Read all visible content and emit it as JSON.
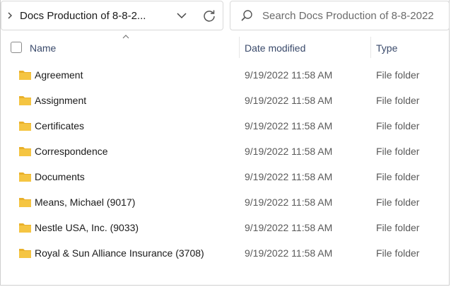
{
  "address_bar": {
    "path": "Docs Production of 8-8-2...",
    "expand_icon": "chevron-right-icon",
    "history_icon": "chevron-down-icon",
    "refresh_icon": "refresh-icon"
  },
  "search": {
    "placeholder": "Search Docs Production of 8-8-2022",
    "icon": "search-icon"
  },
  "columns": {
    "name": "Name",
    "date_modified": "Date modified",
    "type": "Type",
    "sort_icon": "sort-ascending-caret-icon"
  },
  "rows": [
    {
      "name": "Agreement",
      "date": "9/19/2022 11:58 AM",
      "type": "File folder"
    },
    {
      "name": "Assignment",
      "date": "9/19/2022 11:58 AM",
      "type": "File folder"
    },
    {
      "name": "Certificates",
      "date": "9/19/2022 11:58 AM",
      "type": "File folder"
    },
    {
      "name": "Correspondence",
      "date": "9/19/2022 11:58 AM",
      "type": "File folder"
    },
    {
      "name": "Documents",
      "date": "9/19/2022 11:58 AM",
      "type": "File folder"
    },
    {
      "name": "Means, Michael (9017)",
      "date": "9/19/2022 11:58 AM",
      "type": "File folder"
    },
    {
      "name": "Nestle USA, Inc. (9033)",
      "date": "9/19/2022 11:58 AM",
      "type": "File folder"
    },
    {
      "name": "Royal & Sun Alliance Insurance (3708)",
      "date": "9/19/2022 11:58 AM",
      "type": "File folder"
    }
  ],
  "colors": {
    "folder_fill": "#f5c542",
    "folder_tab": "#e9b02a",
    "header_text": "#3a4a6b"
  }
}
